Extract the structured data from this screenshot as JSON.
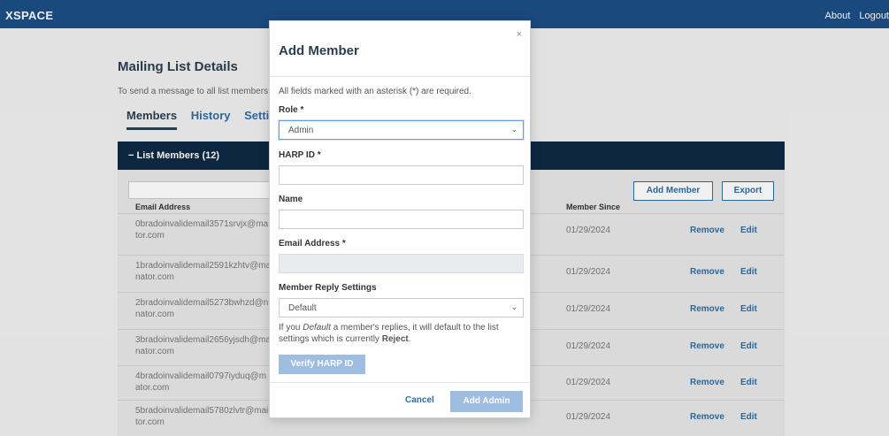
{
  "topbar": {
    "brand": "XSPACE",
    "about": "About",
    "logout": "Logout"
  },
  "page": {
    "title": "Mailing List Details",
    "description": "To send a message to all list members,",
    "tabs": [
      "Members",
      "History",
      "Setti"
    ]
  },
  "members_section": {
    "header": "− List Members (12)",
    "add_member": "Add Member",
    "export": "Export",
    "columns": {
      "email": "Email Address",
      "since": "Member Since"
    },
    "rows": [
      {
        "email": "0bradoinvalidemail3571srvjx@ma ator.com",
        "since": "01/29/2024",
        "remove": "Remove",
        "edit": "Edit"
      },
      {
        "email": "1bradoinvalidemail2591kzhtv@ma nator.com",
        "since": "01/29/2024",
        "remove": "Remove",
        "edit": "Edit"
      },
      {
        "email": "2bradoinvalidemail5273bwhzd@n inator.com",
        "since": "01/29/2024",
        "remove": "Remove",
        "edit": "Edit"
      },
      {
        "email": "3bradoinvalidemail2656yjsdh@ma nator.com",
        "since": "01/29/2024",
        "remove": "Remove",
        "edit": "Edit"
      },
      {
        "email": "4bradoinvalidemail0797iyduq@m nator.com",
        "since": "01/29/2024",
        "remove": "Remove",
        "edit": "Edit"
      },
      {
        "email": "5bradoinvalidemail5780zlvtr@mai ator.com",
        "since": "01/29/2024",
        "remove": "Remove",
        "edit": "Edit"
      }
    ]
  },
  "modal": {
    "title": "Add Member",
    "close": "×",
    "required_note": "All fields marked with an asterisk (*) are required.",
    "role": {
      "label": "Role *",
      "value": "Admin"
    },
    "harp_id": {
      "label": "HARP ID *",
      "value": ""
    },
    "name": {
      "label": "Name",
      "value": ""
    },
    "email": {
      "label": "Email Address *",
      "value": ""
    },
    "reply": {
      "label": "Member Reply Settings",
      "value": "Default"
    },
    "help": {
      "p1": "If you ",
      "em": "Default",
      "p2": " a member's replies, it will default to the list settings which is currently ",
      "strong": "Reject",
      "p3": "."
    },
    "verify_button": "Verify HARP ID",
    "cancel_button": "Cancel",
    "submit_button": "Add Admin"
  }
}
